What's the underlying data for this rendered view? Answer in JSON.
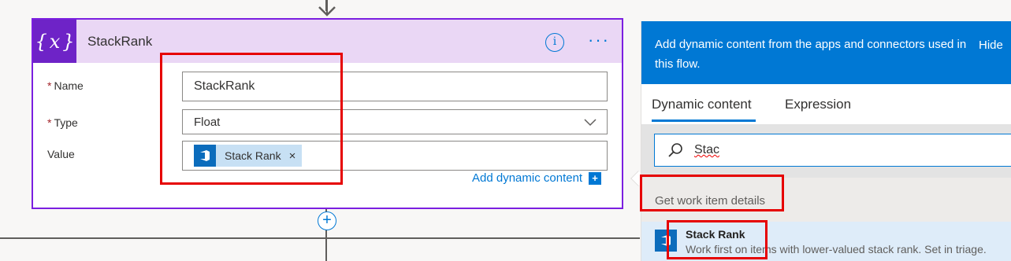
{
  "action": {
    "title": "StackRank",
    "fields": {
      "name_label": "Name",
      "name_value": "StackRank",
      "type_label": "Type",
      "type_value": "Float",
      "value_label": "Value",
      "value_token": "Stack Rank"
    },
    "add_dynamic_label": "Add dynamic content"
  },
  "panel": {
    "description": "Add dynamic content from the apps and connectors used in this flow.",
    "hide_label": "Hide",
    "tabs": [
      "Dynamic content",
      "Expression"
    ],
    "search_value": "Stac",
    "section_label": "Get work item details",
    "item_title": "Stack Rank",
    "item_description": "Work first on items with lower-valued stack rank. Set in triage."
  },
  "colors": {
    "accent": "#0078d4",
    "variable_purple": "#6e23c7",
    "highlight_red": "#e60000"
  },
  "icons": [
    "variable-icon",
    "info-icon",
    "more-icon",
    "chevron-down-icon",
    "azure-devops-icon",
    "search-icon",
    "add-step-icon"
  ]
}
